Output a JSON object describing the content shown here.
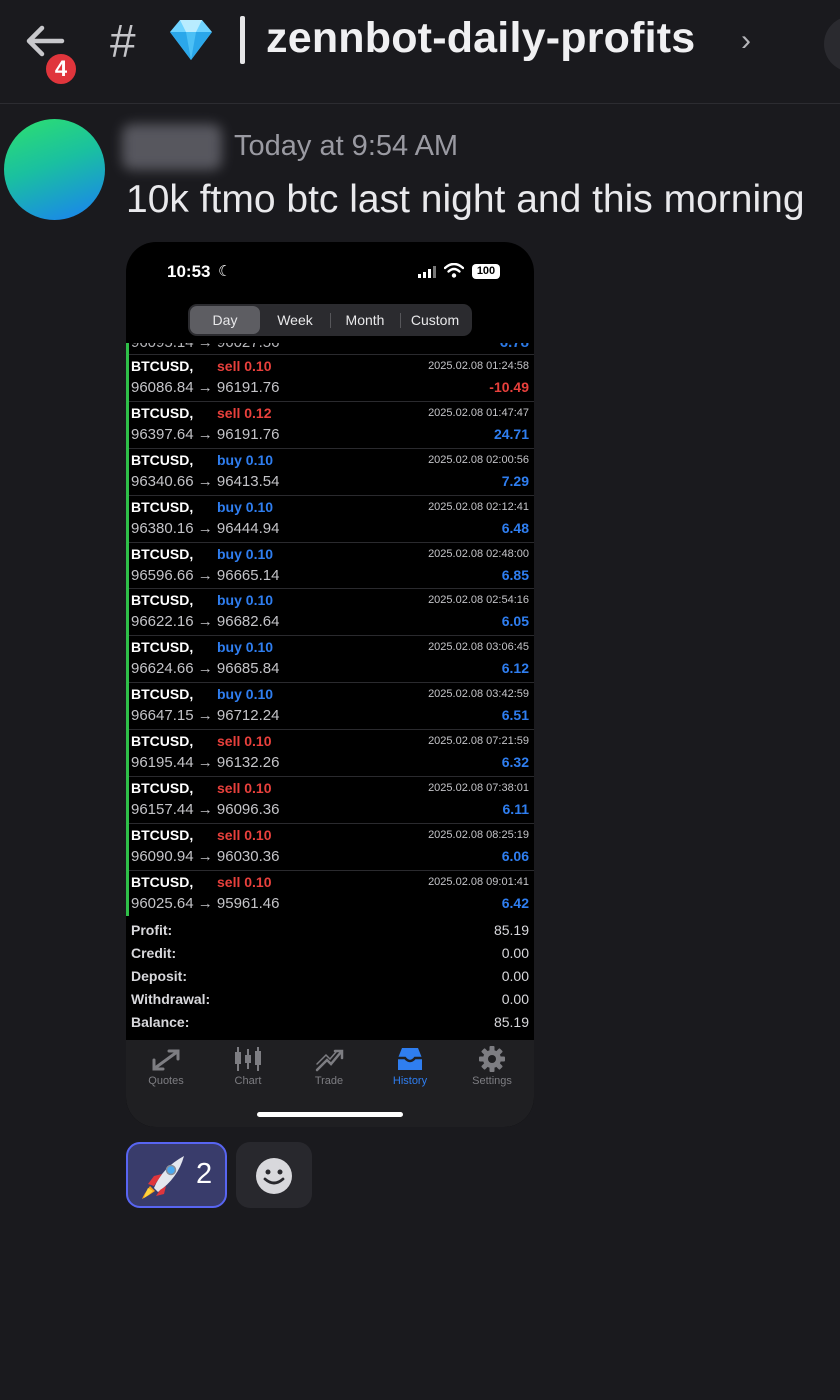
{
  "header": {
    "back_badge": "4",
    "hash": "#",
    "gem_icon": "gem-icon",
    "channel_name": "zennbot-daily-profits",
    "chevron": "›"
  },
  "message": {
    "timestamp": "Today at 9:54 AM",
    "text": "10k ftmo btc last night and this morning"
  },
  "phone": {
    "status_time": "10:53",
    "battery": "100",
    "segments": [
      "Day",
      "Week",
      "Month",
      "Custom"
    ],
    "active_segment": "Day",
    "trades": [
      {
        "symbol": "BTCUSD,",
        "direction": "sell 0.10",
        "type": "sell",
        "price": "96086.84 → 96191.76",
        "date": "2025.02.08 01:24:58",
        "profit": "-10.49"
      },
      {
        "symbol": "BTCUSD,",
        "direction": "sell 0.12",
        "type": "sell",
        "price": "96397.64 → 96191.76",
        "date": "2025.02.08 01:47:47",
        "profit": "24.71"
      },
      {
        "symbol": "BTCUSD,",
        "direction": "buy 0.10",
        "type": "buy",
        "price": "96340.66 → 96413.54",
        "date": "2025.02.08 02:00:56",
        "profit": "7.29"
      },
      {
        "symbol": "BTCUSD,",
        "direction": "buy 0.10",
        "type": "buy",
        "price": "96380.16 → 96444.94",
        "date": "2025.02.08 02:12:41",
        "profit": "6.48"
      },
      {
        "symbol": "BTCUSD,",
        "direction": "buy 0.10",
        "type": "buy",
        "price": "96596.66 → 96665.14",
        "date": "2025.02.08 02:48:00",
        "profit": "6.85"
      },
      {
        "symbol": "BTCUSD,",
        "direction": "buy 0.10",
        "type": "buy",
        "price": "96622.16 → 96682.64",
        "date": "2025.02.08 02:54:16",
        "profit": "6.05"
      },
      {
        "symbol": "BTCUSD,",
        "direction": "buy 0.10",
        "type": "buy",
        "price": "96624.66 → 96685.84",
        "date": "2025.02.08 03:06:45",
        "profit": "6.12"
      },
      {
        "symbol": "BTCUSD,",
        "direction": "buy 0.10",
        "type": "buy",
        "price": "96647.15 → 96712.24",
        "date": "2025.02.08 03:42:59",
        "profit": "6.51"
      },
      {
        "symbol": "BTCUSD,",
        "direction": "sell 0.10",
        "type": "sell",
        "price": "96195.44 → 96132.26",
        "date": "2025.02.08 07:21:59",
        "profit": "6.32"
      },
      {
        "symbol": "BTCUSD,",
        "direction": "sell 0.10",
        "type": "sell",
        "price": "96157.44 → 96096.36",
        "date": "2025.02.08 07:38:01",
        "profit": "6.11"
      },
      {
        "symbol": "BTCUSD,",
        "direction": "sell 0.10",
        "type": "sell",
        "price": "96090.94 → 96030.36",
        "date": "2025.02.08 08:25:19",
        "profit": "6.06"
      },
      {
        "symbol": "BTCUSD,",
        "direction": "sell 0.10",
        "type": "sell",
        "price": "96025.64 → 95961.46",
        "date": "2025.02.08 09:01:41",
        "profit": "6.42"
      }
    ],
    "summary": [
      {
        "label": "Profit:",
        "value": "85.19"
      },
      {
        "label": "Credit:",
        "value": "0.00"
      },
      {
        "label": "Deposit:",
        "value": "0.00"
      },
      {
        "label": "Withdrawal:",
        "value": "0.00"
      },
      {
        "label": "Balance:",
        "value": "85.19"
      }
    ],
    "tabs": [
      {
        "label": "Quotes",
        "icon": "quotes-icon"
      },
      {
        "label": "Chart",
        "icon": "chart-icon"
      },
      {
        "label": "Trade",
        "icon": "trade-icon"
      },
      {
        "label": "History",
        "icon": "history-icon"
      },
      {
        "label": "Settings",
        "icon": "settings-icon"
      }
    ],
    "active_tab": "History"
  },
  "reactions": {
    "rocket_emoji": "rocket-icon",
    "rocket_count": "2",
    "add_reaction_icon": "add-reaction-icon"
  },
  "colors": {
    "background": "#1a1a1e",
    "badge": "#e0353c",
    "buy_blue": "#2f7ef0",
    "sell_red": "#e8403c",
    "reaction_border": "#5865f2"
  }
}
